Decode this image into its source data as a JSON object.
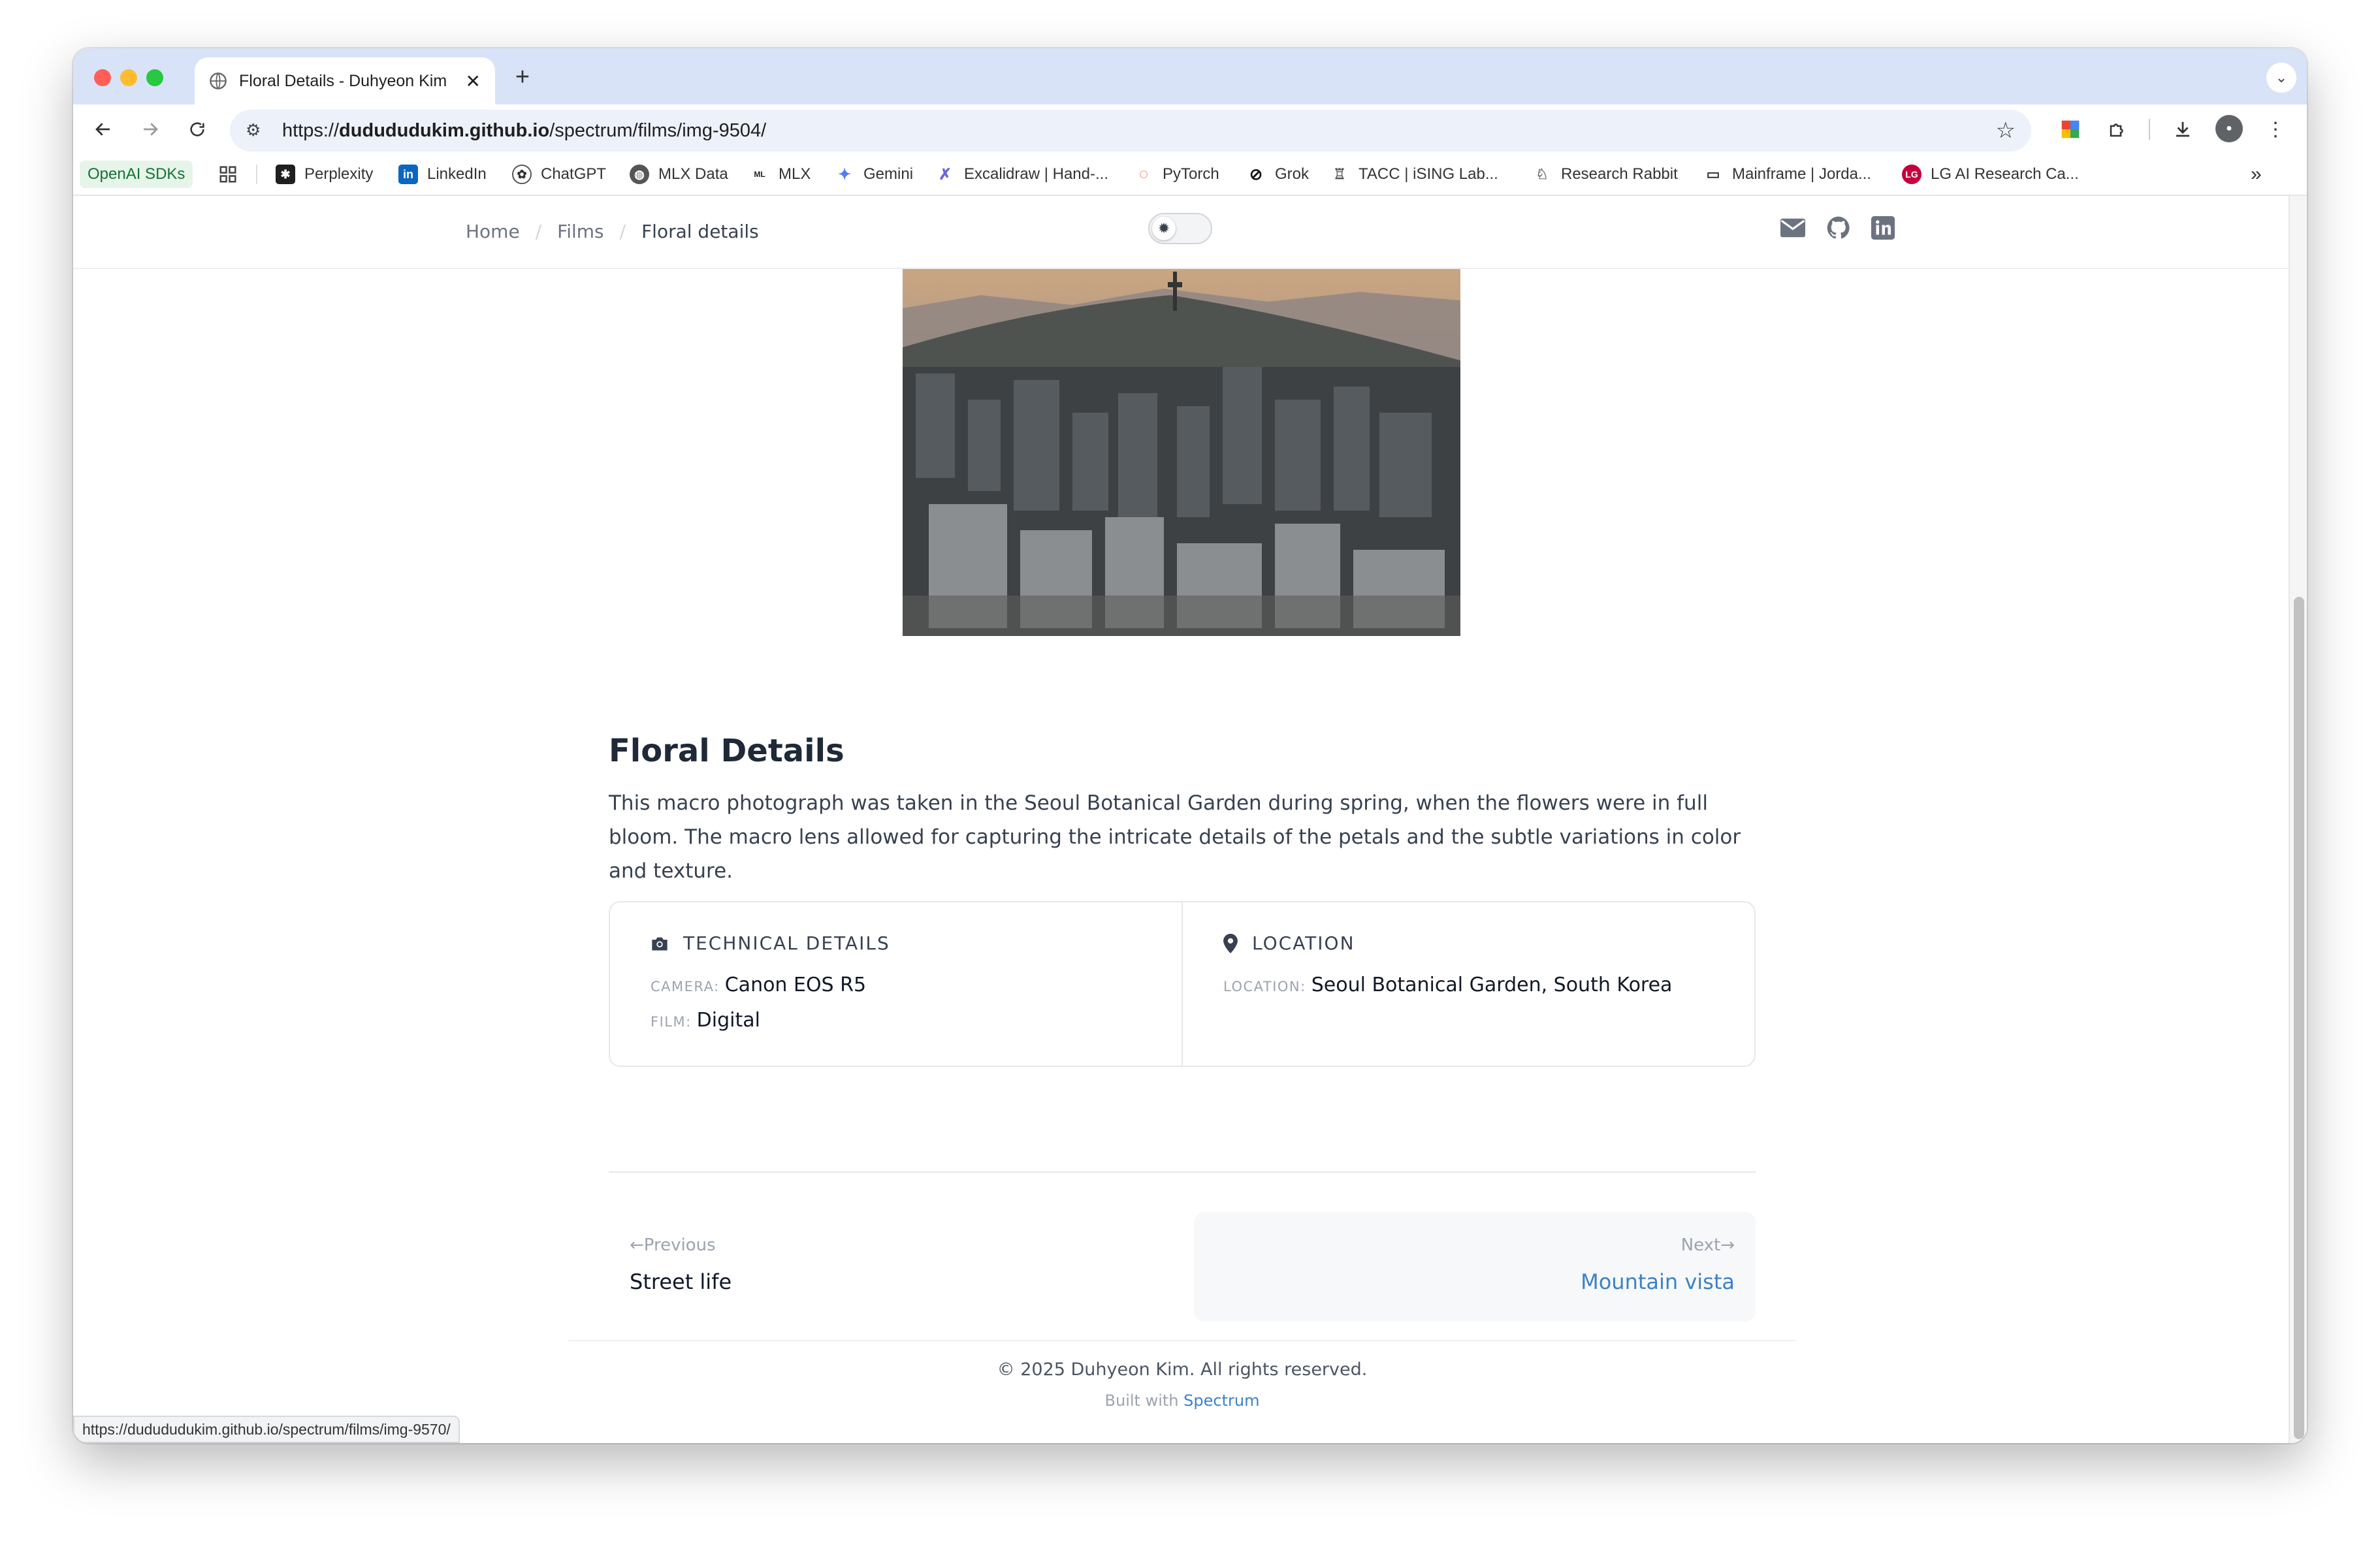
{
  "browser": {
    "tab_title": "Floral Details - Duhyeon Kim",
    "url_prefix": "https://",
    "url_domain": "dudududukim.github.io",
    "url_path": "/spectrum/films/img-9504/",
    "new_tab_label": "+",
    "status_url": "https://dudududukim.github.io/spectrum/films/img-9570/",
    "bookmarks": [
      {
        "label": "OpenAI SDKs",
        "icon": "tag"
      },
      {
        "label": "",
        "icon": "apps-grid-icon"
      },
      {
        "label": "Perplexity",
        "icon": "perplexity-icon"
      },
      {
        "label": "LinkedIn",
        "icon": "linkedin-icon"
      },
      {
        "label": "ChatGPT",
        "icon": "chatgpt-icon"
      },
      {
        "label": "MLX Data",
        "icon": "globe-icon"
      },
      {
        "label": "MLX",
        "icon": "mlx-icon"
      },
      {
        "label": "Gemini",
        "icon": "gemini-icon"
      },
      {
        "label": "Excalidraw | Hand-...",
        "icon": "excalidraw-icon"
      },
      {
        "label": "PyTorch",
        "icon": "pytorch-icon"
      },
      {
        "label": "Grok",
        "icon": "grok-icon"
      },
      {
        "label": "TACC | iSING Lab...",
        "icon": "tacc-icon"
      },
      {
        "label": "Research Rabbit",
        "icon": "rabbit-icon"
      },
      {
        "label": "Mainframe | Jorda...",
        "icon": "mainframe-icon"
      },
      {
        "label": "LG AI Research Ca...",
        "icon": "lg-icon"
      }
    ],
    "colors": {
      "tabbar": "#d8e3f8",
      "urlbar": "#edf1f9"
    }
  },
  "site": {
    "breadcrumb": {
      "home": "Home",
      "films": "Films",
      "current": "Floral details",
      "sep": "/"
    },
    "title": "Floral Details",
    "description": "This macro photograph was taken in the Seoul Botanical Garden during spring, when the flowers were in full bloom. The macro lens allowed for capturing the intricate details of the petals and the subtle variations in color and texture.",
    "technical": {
      "heading": "TECHNICAL DETAILS",
      "camera_label": "CAMERA:",
      "camera": "Canon EOS R5",
      "film_label": "FILM:",
      "film": "Digital"
    },
    "location": {
      "heading": "LOCATION",
      "label": "LOCATION:",
      "value": "Seoul Botanical Garden, South Korea"
    },
    "nav": {
      "prev_label": "Previous",
      "prev_arrow": "←",
      "prev_title": "Street life",
      "next_label": "Next",
      "next_arrow": "→",
      "next_title": "Mountain vista"
    },
    "footer": {
      "copyright": "© 2025 Duhyeon Kim. All rights reserved.",
      "built_with": "Built with",
      "built_link": "Spectrum"
    },
    "colors": {
      "link": "#3b82c4",
      "text": "#1f2937",
      "muted": "#9ca3af"
    }
  }
}
